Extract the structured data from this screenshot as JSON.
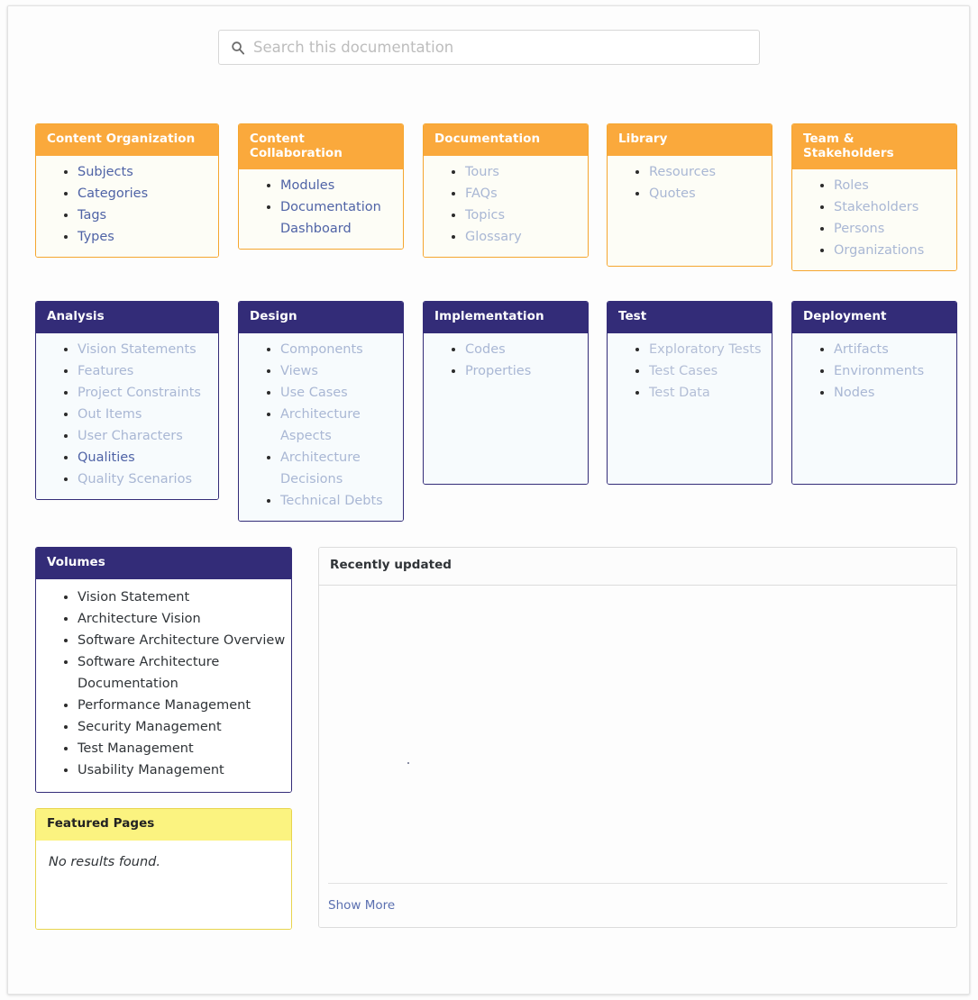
{
  "search": {
    "placeholder": "Search this documentation",
    "value": "",
    "icon": "search-icon"
  },
  "cards_row1": [
    {
      "title": "Content Organization",
      "theme": "orange",
      "items": [
        {
          "label": "Subjects",
          "state": "active"
        },
        {
          "label": "Categories",
          "state": "active"
        },
        {
          "label": "Tags",
          "state": "active"
        },
        {
          "label": "Types",
          "state": "active"
        }
      ]
    },
    {
      "title": "Content Collaboration",
      "theme": "orange",
      "items": [
        {
          "label": "Modules",
          "state": "active"
        },
        {
          "label": "Documentation Dashboard",
          "state": "active"
        }
      ]
    },
    {
      "title": "Documentation",
      "theme": "orange",
      "items": [
        {
          "label": "Tours",
          "state": "muted"
        },
        {
          "label": "FAQs",
          "state": "muted"
        },
        {
          "label": "Topics",
          "state": "muted"
        },
        {
          "label": "Glossary",
          "state": "muted"
        }
      ]
    },
    {
      "title": "Library",
      "theme": "orange",
      "items": [
        {
          "label": "Resources",
          "state": "muted"
        },
        {
          "label": "Quotes",
          "state": "muted"
        }
      ]
    },
    {
      "title": "Team & Stakeholders",
      "theme": "orange",
      "items": [
        {
          "label": "Roles",
          "state": "muted"
        },
        {
          "label": "Stakeholders",
          "state": "muted"
        },
        {
          "label": "Persons",
          "state": "muted"
        },
        {
          "label": "Organizations",
          "state": "muted"
        }
      ]
    }
  ],
  "cards_row2": [
    {
      "title": "Analysis",
      "theme": "purple",
      "items": [
        {
          "label": "Vision Statements",
          "state": "muted"
        },
        {
          "label": "Features",
          "state": "muted"
        },
        {
          "label": "Project Constraints",
          "state": "muted"
        },
        {
          "label": "Out Items",
          "state": "muted"
        },
        {
          "label": "User Characters",
          "state": "muted"
        },
        {
          "label": "Qualities",
          "state": "active"
        },
        {
          "label": "Quality Scenarios",
          "state": "muted"
        }
      ]
    },
    {
      "title": "Design",
      "theme": "purple",
      "items": [
        {
          "label": "Components",
          "state": "muted"
        },
        {
          "label": "Views",
          "state": "muted"
        },
        {
          "label": "Use Cases",
          "state": "muted"
        },
        {
          "label": "Architecture Aspects",
          "state": "muted"
        },
        {
          "label": "Architecture Decisions",
          "state": "muted"
        },
        {
          "label": "Technical Debts",
          "state": "muted"
        }
      ]
    },
    {
      "title": "Implementation",
      "theme": "purple",
      "items": [
        {
          "label": "Codes",
          "state": "muted"
        },
        {
          "label": "Properties",
          "state": "muted"
        }
      ]
    },
    {
      "title": "Test",
      "theme": "purple",
      "items": [
        {
          "label": "Exploratory Tests",
          "state": "muted"
        },
        {
          "label": "Test Cases",
          "state": "muted"
        },
        {
          "label": "Test Data",
          "state": "muted"
        }
      ]
    },
    {
      "title": "Deployment",
      "theme": "purple",
      "items": [
        {
          "label": "Artifacts",
          "state": "muted"
        },
        {
          "label": "Environments",
          "state": "muted"
        },
        {
          "label": "Nodes",
          "state": "muted"
        }
      ]
    }
  ],
  "volumes": {
    "title": "Volumes",
    "items": [
      "Vision Statement",
      "Architecture Vision",
      "Software Architecture Overview",
      "Software Architecture Documentation",
      "Performance Management",
      "Security Management",
      "Test Management",
      "Usability Management"
    ]
  },
  "featured_pages": {
    "title": "Featured Pages",
    "empty_message": "No results found."
  },
  "recently_updated": {
    "title": "Recently updated",
    "items": [],
    "show_more_label": "Show More"
  },
  "colors": {
    "orange_header": "#faa93c",
    "purple_header": "#332c78",
    "yellow_header": "#fbf380",
    "link_active": "#4f63a6",
    "link_muted": "#a9b7d4",
    "page_background": "#fdfdfd"
  }
}
